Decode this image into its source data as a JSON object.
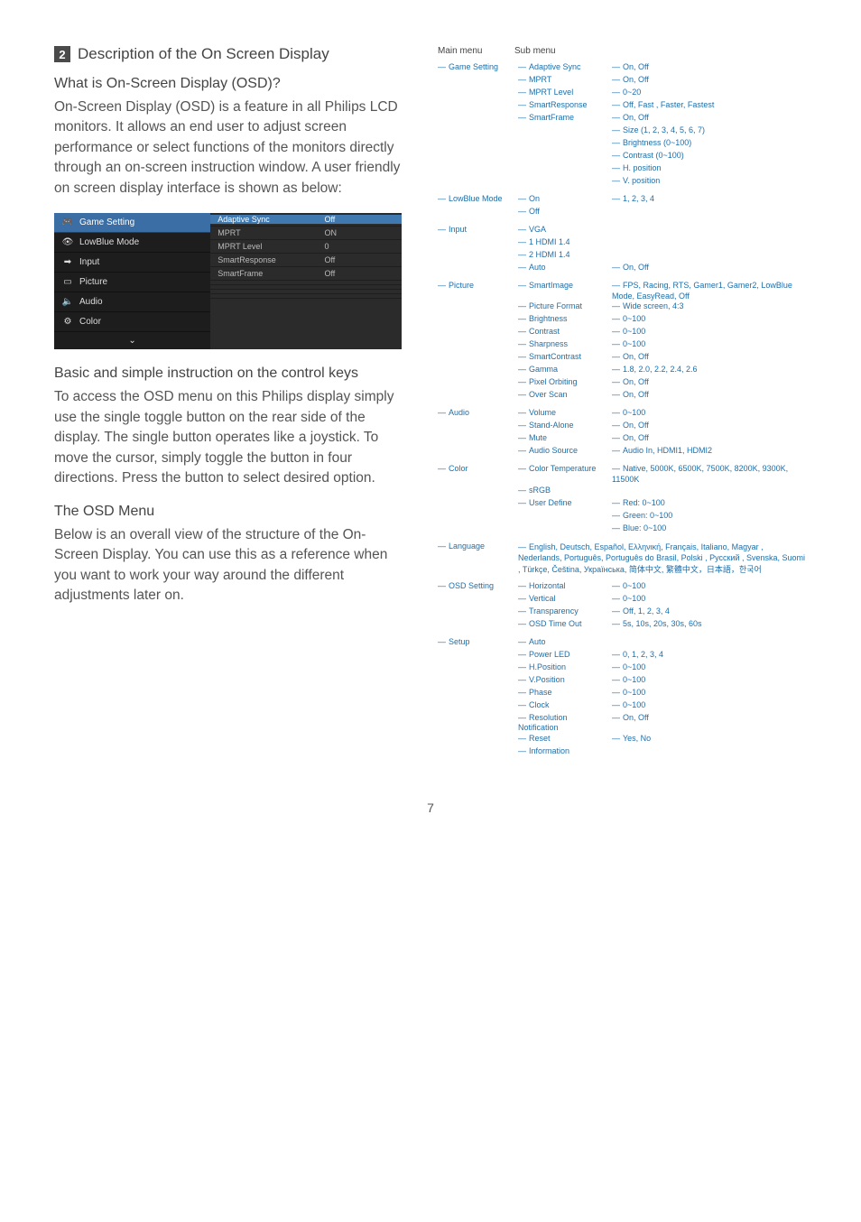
{
  "section": {
    "num": "2",
    "title": "Description of the On Screen Display"
  },
  "q": "What is On-Screen Display (OSD)?",
  "para1": "On-Screen Display (OSD) is a feature in all Philips LCD monitors. It allows an end user to adjust screen performance or select functions of the monitors directly through an on-screen instruction window. A user friendly on screen display interface is shown as below:",
  "basic_h": "Basic and simple instruction on the control keys",
  "para2": "To access the OSD menu on this Philips display simply use the single toggle button on the rear side of the display. The single button operates like a joystick. To move the cursor, simply toggle the button in four directions. Press the button to select desired option.",
  "osd_menu_h": "The OSD Menu",
  "para3": "Below is an overall view of the structure of the On-Screen Display. You can use this as a reference when you want to work your way around the different adjustments later on.",
  "osd_left": [
    {
      "label": "Game Setting",
      "sel": true,
      "icon": "game"
    },
    {
      "label": "LowBlue Mode",
      "icon": "eye"
    },
    {
      "label": "Input",
      "icon": "input"
    },
    {
      "label": "Picture",
      "icon": "picture"
    },
    {
      "label": "Audio",
      "icon": "audio"
    },
    {
      "label": "Color",
      "icon": "color"
    }
  ],
  "osd_right": [
    {
      "k": "Adaptive Sync",
      "v": "Off",
      "sel": true
    },
    {
      "k": "MPRT",
      "v": "ON"
    },
    {
      "k": "MPRT Level",
      "v": "0",
      "bar": true
    },
    {
      "k": "SmartResponse",
      "v": "Off"
    },
    {
      "k": "SmartFrame",
      "v": "Off"
    },
    {
      "k": "",
      "v": ""
    },
    {
      "k": "",
      "v": ""
    },
    {
      "k": "",
      "v": ""
    },
    {
      "k": "",
      "v": ""
    }
  ],
  "tree_head": {
    "main": "Main menu",
    "sub": "Sub menu"
  },
  "tree": [
    {
      "main": "Game Setting",
      "subs": [
        {
          "s": "Adaptive Sync",
          "o": [
            "On, Off"
          ]
        },
        {
          "s": "MPRT",
          "o": [
            "On, Off"
          ]
        },
        {
          "s": "MPRT Level",
          "o": [
            "0~20"
          ]
        },
        {
          "s": "SmartResponse",
          "o": [
            "Off, Fast , Faster, Fastest"
          ]
        },
        {
          "s": "SmartFrame",
          "o": [
            "On, Off",
            "Size (1, 2, 3, 4, 5, 6, 7)",
            "Brightness (0~100)",
            "Contrast (0~100)",
            "H. position",
            "V. position"
          ]
        }
      ]
    },
    {
      "main": "LowBlue Mode",
      "subs": [
        {
          "s": "On",
          "o": [
            "1, 2, 3, 4"
          ]
        },
        {
          "s": "Off",
          "o": []
        }
      ]
    },
    {
      "main": "Input",
      "subs": [
        {
          "s": "VGA",
          "o": []
        },
        {
          "s": "1 HDMI 1.4",
          "o": []
        },
        {
          "s": "2 HDMI 1.4",
          "o": []
        },
        {
          "s": "Auto",
          "o": [
            "On, Off"
          ]
        }
      ]
    },
    {
      "main": "Picture",
      "subs": [
        {
          "s": "SmartImage",
          "o": [
            "FPS, Racing, RTS, Gamer1, Gamer2, LowBlue Mode, EasyRead, Off"
          ]
        },
        {
          "s": "Picture Format",
          "o": [
            "Wide screen, 4:3"
          ]
        },
        {
          "s": "Brightness",
          "o": [
            "0~100"
          ]
        },
        {
          "s": "Contrast",
          "o": [
            "0~100"
          ]
        },
        {
          "s": "Sharpness",
          "o": [
            "0~100"
          ]
        },
        {
          "s": "SmartContrast",
          "o": [
            "On, Off"
          ]
        },
        {
          "s": "Gamma",
          "o": [
            "1.8, 2.0, 2.2, 2.4, 2.6"
          ]
        },
        {
          "s": "Pixel Orbiting",
          "o": [
            "On, Off"
          ]
        },
        {
          "s": "Over Scan",
          "o": [
            "On, Off"
          ]
        }
      ]
    },
    {
      "main": "Audio",
      "subs": [
        {
          "s": "Volume",
          "o": [
            "0~100"
          ]
        },
        {
          "s": "Stand-Alone",
          "o": [
            "On, Off"
          ]
        },
        {
          "s": "Mute",
          "o": [
            "On, Off"
          ]
        },
        {
          "s": "Audio Source",
          "o": [
            "Audio In, HDMI1, HDMI2"
          ]
        }
      ]
    },
    {
      "main": "Color",
      "subs": [
        {
          "s": "Color Temperature",
          "o": [
            "Native, 5000K, 6500K, 7500K, 8200K, 9300K, 11500K"
          ]
        },
        {
          "s": "sRGB",
          "o": []
        },
        {
          "s": "User Define",
          "o": [
            "Red: 0~100",
            "Green: 0~100",
            "Blue: 0~100"
          ]
        }
      ]
    },
    {
      "main": "Language",
      "lang": "English, Deutsch, Español, Ελληνική, Français, Italiano,  Magyar ,  Nederlands, Português, Português do Brasil,  Polski , Русский , Svenska,  Suomi ,  Türkçe,  Čeština,  Українська, 简体中文,  繁體中文，日本語，한국어"
    },
    {
      "main": "OSD Setting",
      "subs": [
        {
          "s": "Horizontal",
          "o": [
            "0~100"
          ]
        },
        {
          "s": "Vertical",
          "o": [
            "0~100"
          ]
        },
        {
          "s": "Transparency",
          "o": [
            "Off, 1, 2, 3, 4"
          ]
        },
        {
          "s": "OSD Time Out",
          "o": [
            "5s, 10s, 20s, 30s, 60s"
          ]
        }
      ]
    },
    {
      "main": "Setup",
      "subs": [
        {
          "s": "Auto",
          "o": []
        },
        {
          "s": "Power LED",
          "o": [
            "0, 1, 2, 3, 4"
          ]
        },
        {
          "s": "H.Position",
          "o": [
            "0~100"
          ]
        },
        {
          "s": "V.Position",
          "o": [
            "0~100"
          ]
        },
        {
          "s": "Phase",
          "o": [
            "0~100"
          ]
        },
        {
          "s": "Clock",
          "o": [
            "0~100"
          ]
        },
        {
          "s": "Resolution Notification",
          "o": [
            "On, Off"
          ]
        },
        {
          "s": "Reset",
          "o": [
            "Yes, No"
          ]
        },
        {
          "s": "Information",
          "o": []
        }
      ]
    }
  ],
  "pagenum": "7"
}
